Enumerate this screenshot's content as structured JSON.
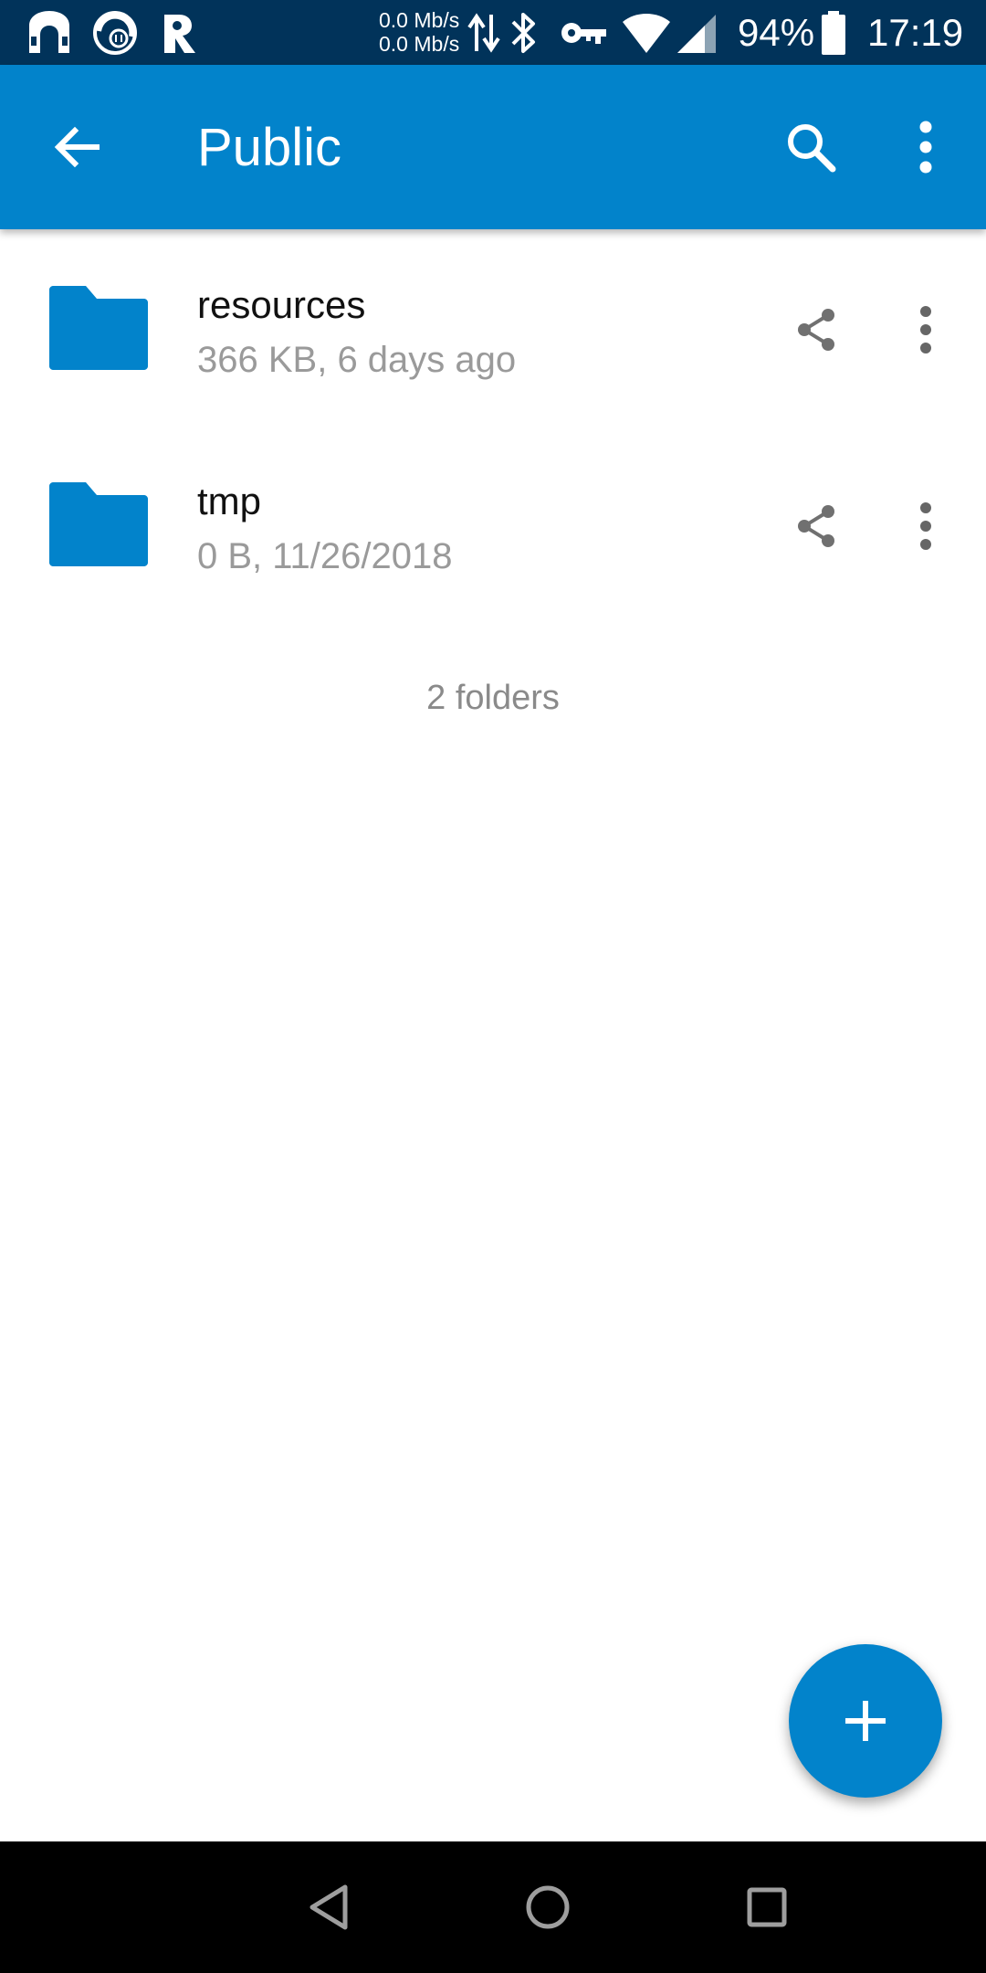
{
  "status_bar": {
    "net_speed_up": "0.0 Mb/s",
    "net_speed_down": "0.0 Mb/s",
    "battery": "94%",
    "time": "17:19",
    "icons": [
      "notification-app-icon-1",
      "notification-app-icon-2",
      "notification-app-icon-3",
      "data-arrows-icon",
      "bluetooth-icon",
      "vpn-key-icon",
      "wifi-icon",
      "cell-signal-icon",
      "battery-icon"
    ]
  },
  "app_bar": {
    "title": "Public",
    "icons": [
      "back-arrow-icon",
      "search-icon",
      "overflow-menu-icon"
    ],
    "color": "#0283cb"
  },
  "items": [
    {
      "name": "resources",
      "details": "366 KB, 6 days ago",
      "type": "folder"
    },
    {
      "name": "tmp",
      "details": "0 B, 11/26/2018",
      "type": "folder"
    }
  ],
  "summary": "2 folders",
  "fab": {
    "icon": "plus-icon"
  },
  "nav_bar": {
    "icons": [
      "back-triangle-icon",
      "home-circle-icon",
      "recents-square-icon"
    ]
  },
  "colors": {
    "status_bar": "#01335a",
    "accent": "#0283cb",
    "folder": "#0283cb",
    "secondary_text": "#9a9a9a"
  }
}
